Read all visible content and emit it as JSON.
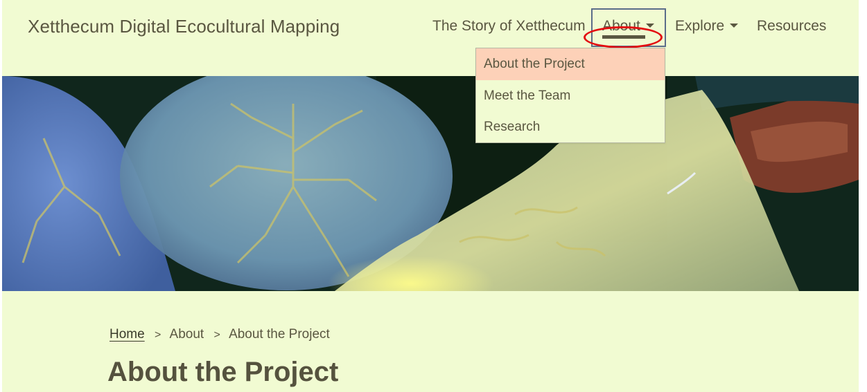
{
  "site": {
    "title": "Xetthecum Digital Ecocultural Mapping"
  },
  "nav": {
    "items": [
      {
        "label": "The Story of Xetthecum"
      },
      {
        "label": "About"
      },
      {
        "label": "Explore"
      },
      {
        "label": "Resources"
      }
    ]
  },
  "dropdown": {
    "items": [
      {
        "label": "About the Project"
      },
      {
        "label": "Meet the Team"
      },
      {
        "label": "Research"
      }
    ]
  },
  "breadcrumb": {
    "home": "Home",
    "separator": ">",
    "section": "About",
    "current": "About the Project"
  },
  "page": {
    "title": "About the Project"
  },
  "colors": {
    "background": "#f1fbd2",
    "text": "#5a5741",
    "dropdown_active": "#fdd1b8",
    "annotation": "#e30b10",
    "focus_border": "#5b6d8a"
  },
  "icons": {
    "caret": "caret-down-icon"
  }
}
